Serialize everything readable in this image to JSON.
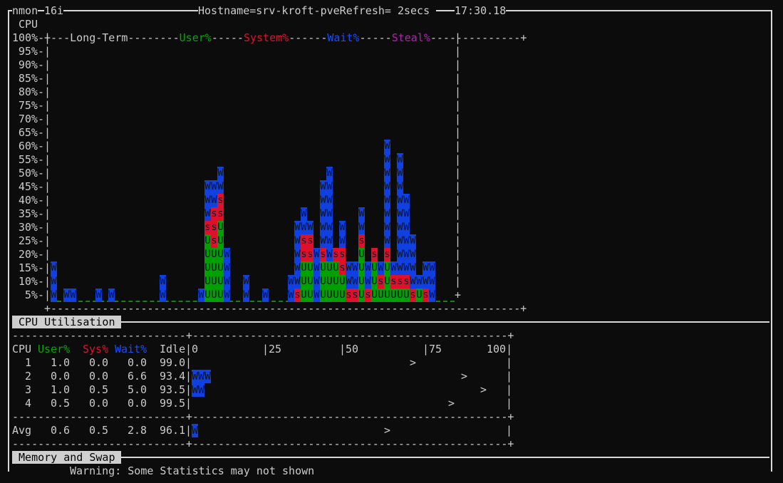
{
  "header": {
    "program": "nmon",
    "version": "16i",
    "hostname_refresh": "Hostname=srv-kroft-pveRefresh= 2secs",
    "time": "17:30.18"
  },
  "long_term": {
    "cpu_label": "CPU",
    "title": "Long-Term",
    "legend": {
      "user": {
        "label": "User%",
        "color": "#00a800"
      },
      "system": {
        "label": "System%",
        "color": "#e0102a"
      },
      "wait": {
        "label": "Wait%",
        "color": "#1040e0"
      },
      "steal": {
        "label": "Steal%",
        "color": "#b020b0"
      }
    },
    "y_ticks": [
      "100%-",
      "95%-",
      "90%-",
      "85%-",
      "80%-",
      "75%-",
      "70%-",
      "65%-",
      "60%-",
      "55%-",
      "50%-",
      "45%-",
      "40%-",
      "35%-",
      "30%-",
      "25%-",
      "20%-",
      "15%-",
      "10%-",
      "5%-"
    ]
  },
  "chart_data": {
    "type": "bar",
    "title": "CPU Long-Term",
    "ylabel": "CPU %",
    "ylim": [
      0,
      100
    ],
    "step_percent": 5,
    "legend_codes": {
      "U": "User%",
      "s": "System%",
      "W": "Wait%"
    },
    "columns_bottom_up": [
      "WWW",
      "",
      "W",
      "W",
      "",
      "",
      "",
      "W",
      "",
      "W",
      "",
      "",
      "",
      "",
      "",
      "",
      "",
      "ww",
      "",
      "",
      "",
      "",
      "",
      "W",
      "UUUUUsWWW",
      "UUUUsssWW",
      "UUUUUUssWW",
      "WWWW",
      "",
      "",
      "WW",
      "",
      "",
      "W",
      "",
      "",
      "",
      "WW",
      "sWWWWW",
      "UUUssWW",
      "UUUssW",
      "WWWW",
      "UUUsWWWWW",
      "UUUWWWWWWW",
      "UUUs",
      "UUssWW",
      "sWW",
      "sWW",
      "UUUUsWW",
      "sWW",
      "UUUs",
      "UsW",
      "UUUsWWWWWWWW",
      "UsW",
      "UsWWWWWWWWW",
      "UsWWWWWW",
      "sWWWW",
      "UW",
      "sWW",
      "WWW"
    ]
  },
  "cpu_util": {
    "title": "CPU Utilisation",
    "headers": {
      "cpu": "CPU",
      "user": "User%",
      "sys": "Sys%",
      "wait": "Wait%",
      "idle": "Idle"
    },
    "scale": {
      "s0": "0",
      "s25": "|25",
      "s50": "|50",
      "s75": "|75",
      "s100": "100|"
    },
    "rows": [
      {
        "cpu": "1",
        "user": "1.0",
        "sys": "0.0",
        "wait": "0.0",
        "idle": "99.0",
        "bar": "",
        "peak_percent": 71
      },
      {
        "cpu": "2",
        "user": "0.0",
        "sys": "0.0",
        "wait": "6.6",
        "idle": "93.4",
        "bar": "WWW",
        "peak_percent": 87.5
      },
      {
        "cpu": "3",
        "user": "1.0",
        "sys": "0.5",
        "wait": "5.0",
        "idle": "93.5",
        "bar": "WW",
        "peak_percent": 93.75
      },
      {
        "cpu": "4",
        "user": "0.5",
        "sys": "0.0",
        "wait": "0.0",
        "idle": "99.5",
        "bar": "",
        "peak_percent": 83.3
      }
    ],
    "avg": {
      "cpu": "Avg",
      "user": "0.6",
      "sys": "0.5",
      "wait": "2.8",
      "idle": "96.1",
      "bar": "W",
      "peak_percent": 62.5
    },
    "peak_marker": ">"
  },
  "memory": {
    "title": "Memory and Swap"
  },
  "warning": "Warning: Some Statistics may not shown"
}
